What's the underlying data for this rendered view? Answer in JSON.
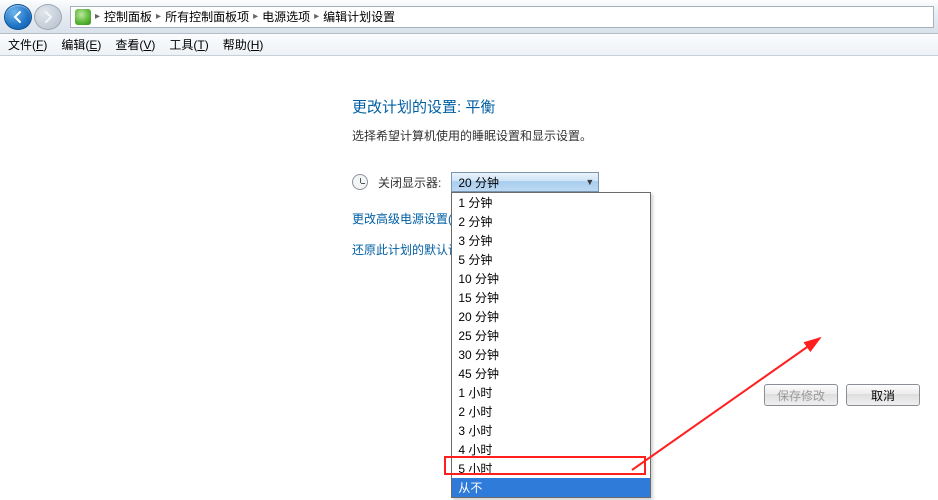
{
  "breadcrumbs": {
    "b0": "控制面板",
    "b1": "所有控制面板项",
    "b2": "电源选项",
    "b3": "编辑计划设置"
  },
  "menu": {
    "file": "文件(",
    "file_u": "F",
    "file_end": ")",
    "edit": "编辑(",
    "edit_u": "E",
    "edit_end": ")",
    "view": "查看(",
    "view_u": "V",
    "view_end": ")",
    "tool": "工具(",
    "tool_u": "T",
    "tool_end": ")",
    "help": "帮助(",
    "help_u": "H",
    "help_end": ")"
  },
  "heading": "更改计划的设置: 平衡",
  "description": "选择希望计算机使用的睡眠设置和显示设置。",
  "field_label": "关闭显示器:",
  "combo_value": "20 分钟",
  "options": {
    "o0": "1 分钟",
    "o1": "2 分钟",
    "o2": "3 分钟",
    "o3": "5 分钟",
    "o4": "10 分钟",
    "o5": "15 分钟",
    "o6": "20 分钟",
    "o7": "25 分钟",
    "o8": "30 分钟",
    "o9": "45 分钟",
    "o10": "1 小时",
    "o11": "2 小时",
    "o12": "3 小时",
    "o13": "4 小时",
    "o14": "5 小时",
    "o15": "从不"
  },
  "link_advanced": "更改高级电源设置(",
  "link_restore": "还原此计划的默认设",
  "btn_save": "保存修改",
  "btn_cancel": "取消"
}
